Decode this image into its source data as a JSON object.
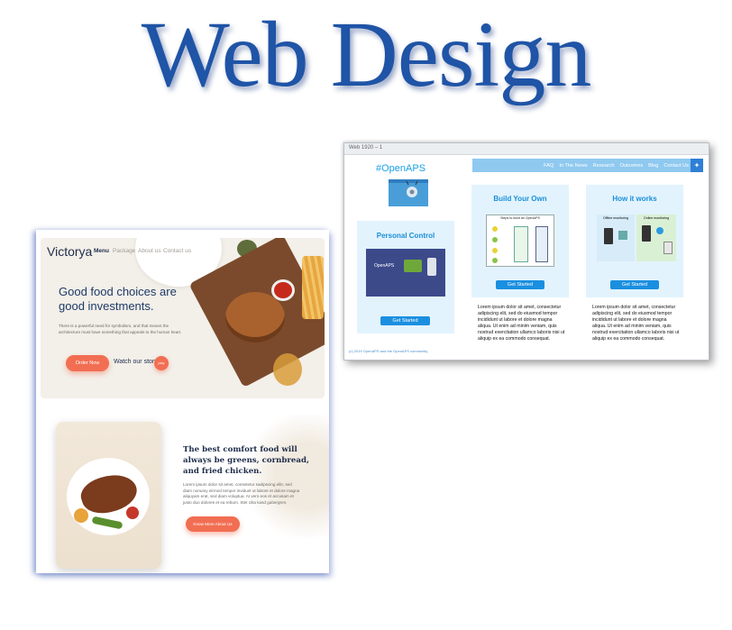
{
  "hero": {
    "title": "Web Design"
  },
  "openaps": {
    "window_title": "Web 1920 – 1",
    "nav": [
      "FAQ",
      "In The News",
      "Research",
      "Outcomes",
      "Blog",
      "Contact Us"
    ],
    "logo": "#OpenAPS",
    "cards": [
      {
        "title": "Personal Control",
        "image_label": "OpenAPS",
        "button": "Get Started"
      },
      {
        "title": "Build Your Own",
        "image_label": "Steps to build an OpenAPS",
        "button": "Get Started",
        "lorem": "Lorem ipsum dolor sit amet, consectetur adipiscing elit, sed do eiusmod tempor incididunt ut labore et dolore magna aliqua. Ut enim ad minim veniam, quis nostrud exercitation ullamco laboris nisi ut aliquip ex ea commodo consequat."
      },
      {
        "title": "How it works",
        "image_labels": [
          "Offline monitoring",
          "Online monitoring"
        ],
        "button": "Get Started",
        "lorem": "Lorem ipsum dolor sit amet, consectetur adipiscing elit, sed do eiusmod tempor incididunt ut labore et dolore magna aliqua. Ut enim ad minim veniam, quis nostrud exercitation ullamco laboris nisi ut aliquip ex ea commodo consequat."
      }
    ],
    "footer": "(c) 2019 OpenAPS and the OpenAPS community",
    "colors": {
      "nav": "#8fc9f0",
      "accent": "#1a8fe0",
      "card": "#e2f3fd"
    }
  },
  "victorya": {
    "brand": "Victorya",
    "nav": [
      "Menu",
      "Package",
      "About us",
      "Contact us"
    ],
    "headline": "Good food choices are good investments.",
    "subtext": "There is a powerful need for symbolism, and that means the architecture must have something that appeals to the human heart.",
    "order_button": "Order Now",
    "watch_label": "Watch our story",
    "play_label": "play",
    "comfort_heading": "The best comfort food will always be greens, cornbread, and fried chicken.",
    "comfort_text": "Lorem ipsum dolor sit amet, consetetur sadipscing elitr, sed diam nonumy eirmod tempor invidunt ut labore et dolore magna aliquyam erat, sed diam voluptua. At vero eos et accusam et justo duo dolores et ea rebum. Stet clita kasd gubergren.",
    "know_button": "Know More About Us",
    "colors": {
      "accent": "#f26e52",
      "navy": "#1e2d4a"
    }
  }
}
